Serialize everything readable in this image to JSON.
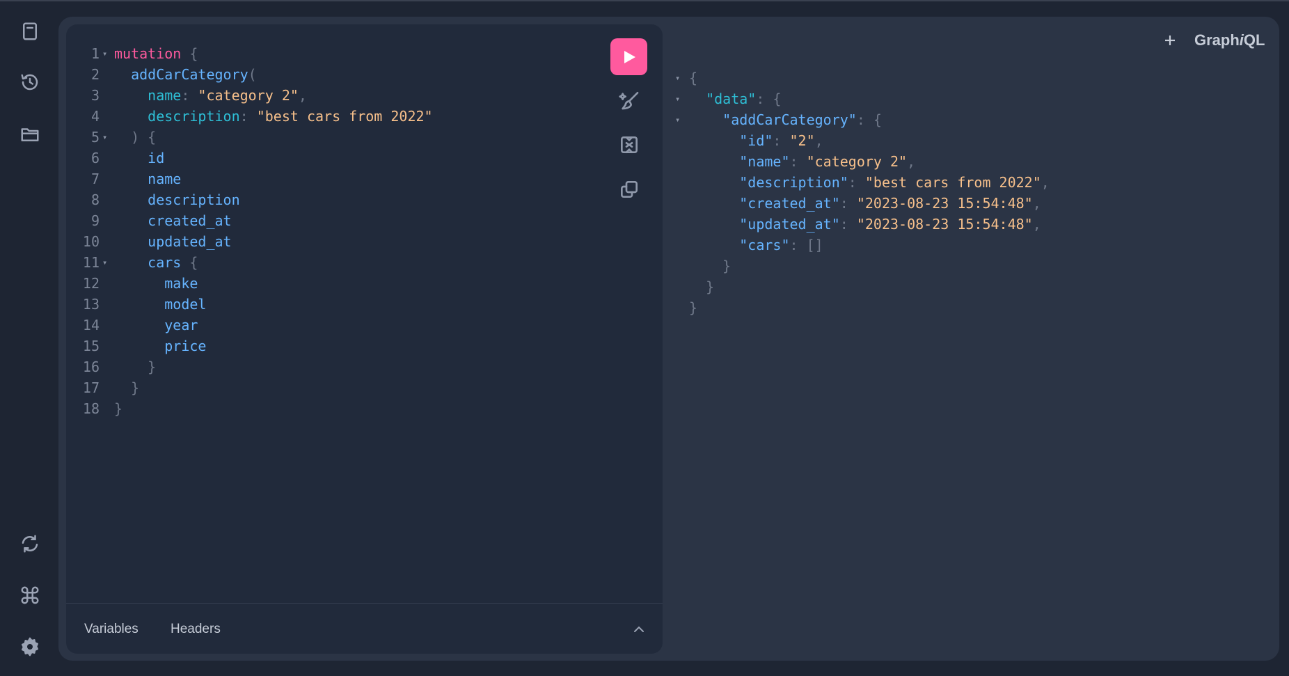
{
  "app": {
    "brand_pre": "Graph",
    "brand_i": "i",
    "brand_post": "QL"
  },
  "rail": {
    "items": [
      {
        "name": "docs-icon"
      },
      {
        "name": "history-icon"
      },
      {
        "name": "explorer-folder-icon"
      },
      {
        "name": "refetch-schema-icon"
      },
      {
        "name": "shortcuts-command-icon"
      },
      {
        "name": "settings-gear-icon"
      }
    ]
  },
  "editor": {
    "lines": [
      {
        "n": "1",
        "fold": true,
        "tokens": [
          [
            "kw",
            "mutation"
          ],
          [
            "pun",
            " {"
          ]
        ]
      },
      {
        "n": "2",
        "fold": false,
        "tokens": [
          [
            "fn",
            "  addCarCategory"
          ],
          [
            "pun",
            "("
          ]
        ]
      },
      {
        "n": "3",
        "fold": false,
        "tokens": [
          [
            "arg",
            "    name"
          ],
          [
            "pun",
            ": "
          ],
          [
            "str",
            "\"category 2\""
          ],
          [
            "pun",
            ","
          ]
        ]
      },
      {
        "n": "4",
        "fold": false,
        "tokens": [
          [
            "arg",
            "    description"
          ],
          [
            "pun",
            ": "
          ],
          [
            "str",
            "\"best cars from 2022\""
          ]
        ]
      },
      {
        "n": "5",
        "fold": true,
        "tokens": [
          [
            "pun",
            "  ) {"
          ]
        ]
      },
      {
        "n": "6",
        "fold": false,
        "tokens": [
          [
            "fld",
            "    id"
          ]
        ]
      },
      {
        "n": "7",
        "fold": false,
        "tokens": [
          [
            "fld",
            "    name"
          ]
        ]
      },
      {
        "n": "8",
        "fold": false,
        "tokens": [
          [
            "fld",
            "    description"
          ]
        ]
      },
      {
        "n": "9",
        "fold": false,
        "tokens": [
          [
            "fld",
            "    created_at"
          ]
        ]
      },
      {
        "n": "10",
        "fold": false,
        "tokens": [
          [
            "fld",
            "    updated_at"
          ]
        ]
      },
      {
        "n": "11",
        "fold": true,
        "tokens": [
          [
            "fld",
            "    cars"
          ],
          [
            "pun",
            " {"
          ]
        ]
      },
      {
        "n": "12",
        "fold": false,
        "tokens": [
          [
            "fld",
            "      make"
          ]
        ]
      },
      {
        "n": "13",
        "fold": false,
        "tokens": [
          [
            "fld",
            "      model"
          ]
        ]
      },
      {
        "n": "14",
        "fold": false,
        "tokens": [
          [
            "fld",
            "      year"
          ]
        ]
      },
      {
        "n": "15",
        "fold": false,
        "tokens": [
          [
            "fld",
            "      price"
          ]
        ]
      },
      {
        "n": "16",
        "fold": false,
        "tokens": [
          [
            "pun",
            "    }"
          ]
        ]
      },
      {
        "n": "17",
        "fold": false,
        "tokens": [
          [
            "pun",
            "  }"
          ]
        ]
      },
      {
        "n": "18",
        "fold": false,
        "tokens": [
          [
            "pun",
            "}"
          ]
        ]
      }
    ]
  },
  "toolbar": {
    "run": "run-query-button",
    "prettify": "prettify-icon",
    "merge": "merge-fragments-icon",
    "copy": "copy-query-icon"
  },
  "bottom_tabs": {
    "variables": "Variables",
    "headers": "Headers"
  },
  "result": {
    "lines": [
      {
        "fold": true,
        "tokens": [
          [
            "pun",
            "{"
          ]
        ]
      },
      {
        "fold": true,
        "tokens": [
          [
            "key-data",
            "  \"data\""
          ],
          [
            "pun",
            ": {"
          ]
        ]
      },
      {
        "fold": true,
        "tokens": [
          [
            "key",
            "    \"addCarCategory\""
          ],
          [
            "pun",
            ": {"
          ]
        ]
      },
      {
        "fold": false,
        "tokens": [
          [
            "key",
            "      \"id\""
          ],
          [
            "pun",
            ": "
          ],
          [
            "str",
            "\"2\""
          ],
          [
            "pun",
            ","
          ]
        ]
      },
      {
        "fold": false,
        "tokens": [
          [
            "key",
            "      \"name\""
          ],
          [
            "pun",
            ": "
          ],
          [
            "str",
            "\"category 2\""
          ],
          [
            "pun",
            ","
          ]
        ]
      },
      {
        "fold": false,
        "tokens": [
          [
            "key",
            "      \"description\""
          ],
          [
            "pun",
            ": "
          ],
          [
            "str",
            "\"best cars from 2022\""
          ],
          [
            "pun",
            ","
          ]
        ]
      },
      {
        "fold": false,
        "tokens": [
          [
            "key",
            "      \"created_at\""
          ],
          [
            "pun",
            ": "
          ],
          [
            "str",
            "\"2023-08-23 15:54:48\""
          ],
          [
            "pun",
            ","
          ]
        ]
      },
      {
        "fold": false,
        "tokens": [
          [
            "key",
            "      \"updated_at\""
          ],
          [
            "pun",
            ": "
          ],
          [
            "str",
            "\"2023-08-23 15:54:48\""
          ],
          [
            "pun",
            ","
          ]
        ]
      },
      {
        "fold": false,
        "tokens": [
          [
            "key",
            "      \"cars\""
          ],
          [
            "pun",
            ": []"
          ]
        ]
      },
      {
        "fold": false,
        "tokens": [
          [
            "pun",
            "    }"
          ]
        ]
      },
      {
        "fold": false,
        "tokens": [
          [
            "pun",
            "  }"
          ]
        ]
      },
      {
        "fold": false,
        "tokens": [
          [
            "pun",
            "}"
          ]
        ]
      }
    ]
  },
  "colors": {
    "accent": "#ff5a9e",
    "keyword": "#ff5a9e",
    "field": "#66b4ff",
    "argument": "#2ebfd6",
    "string": "#f7c08b",
    "punctuation": "#6f7889"
  }
}
